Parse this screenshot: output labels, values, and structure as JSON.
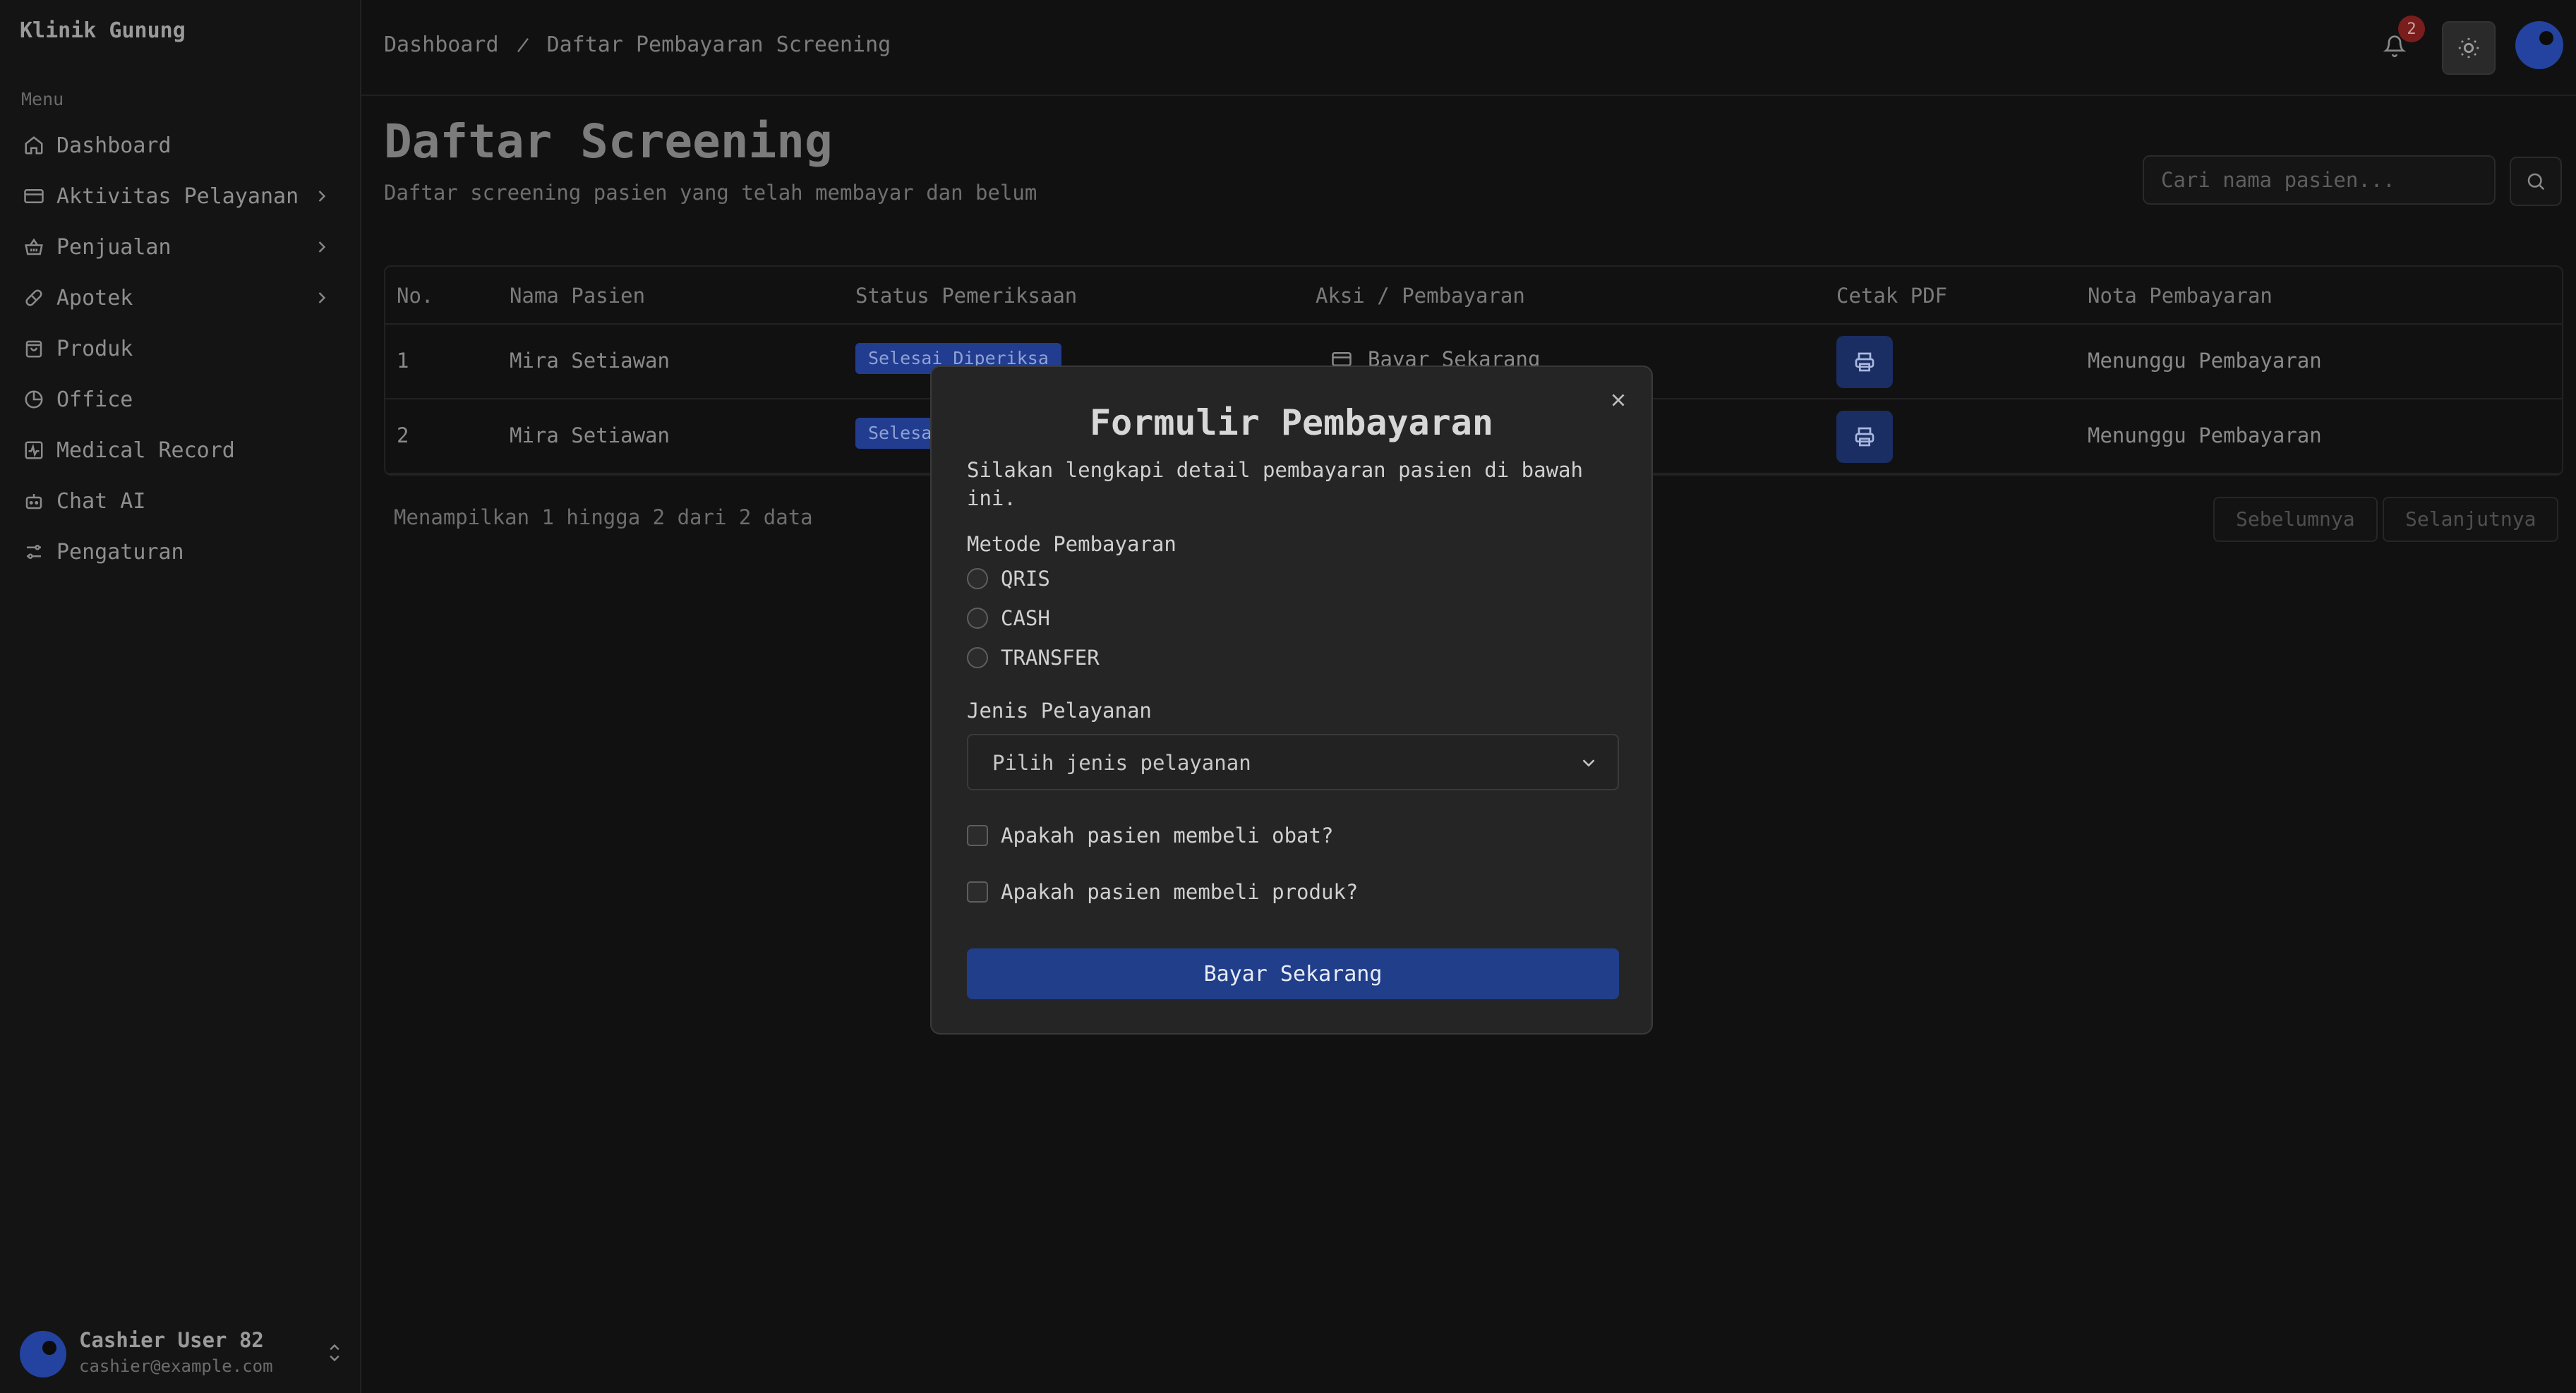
{
  "app": {
    "brand": "Klinik Gunung",
    "menu_label": "Menu"
  },
  "sidebar": {
    "items": [
      {
        "label": "Dashboard",
        "icon": "home-icon",
        "has_children": false
      },
      {
        "label": "Aktivitas Pelayanan",
        "icon": "card-icon",
        "has_children": true
      },
      {
        "label": "Penjualan",
        "icon": "basket-icon",
        "has_children": true
      },
      {
        "label": "Apotek",
        "icon": "pill-icon",
        "has_children": true
      },
      {
        "label": "Produk",
        "icon": "bag-icon",
        "has_children": false
      },
      {
        "label": "Office",
        "icon": "pie-chart-icon",
        "has_children": false
      },
      {
        "label": "Medical Record",
        "icon": "activity-icon",
        "has_children": false
      },
      {
        "label": "Chat AI",
        "icon": "bot-icon",
        "has_children": false
      },
      {
        "label": "Pengaturan",
        "icon": "sliders-icon",
        "has_children": false
      }
    ]
  },
  "user": {
    "name": "Cashier User 82",
    "email": "cashier@example.com"
  },
  "header": {
    "breadcrumb": [
      "Dashboard",
      "Daftar Pembayaran Screening"
    ],
    "notification_count": "2"
  },
  "page": {
    "title": "Daftar Screening",
    "subtitle": "Daftar screening pasien yang telah membayar dan belum",
    "search_placeholder": "Cari nama pasien..."
  },
  "table": {
    "headers": [
      "No.",
      "Nama Pasien",
      "Status Pemeriksaan",
      "Aksi / Pembayaran",
      "Cetak PDF",
      "Nota Pembayaran"
    ],
    "rows": [
      {
        "no": "1",
        "name": "Mira Setiawan",
        "status": "Selesai Diperiksa",
        "action": "Bayar Sekarang",
        "nota": "Menunggu Pembayaran"
      },
      {
        "no": "2",
        "name": "Mira Setiawan",
        "status": "Selesa",
        "action": "",
        "nota": "Menunggu Pembayaran"
      }
    ]
  },
  "pagination": {
    "info": "Menampilkan 1 hingga 2 dari 2 data",
    "prev": "Sebelumnya",
    "next": "Selanjutnya"
  },
  "modal": {
    "title": "Formulir Pembayaran",
    "description": "Silakan lengkapi detail pembayaran pasien di bawah ini.",
    "payment_method_label": "Metode Pembayaran",
    "payment_methods": [
      "QRIS",
      "CASH",
      "TRANSFER"
    ],
    "service_label": "Jenis Pelayanan",
    "service_placeholder": "Pilih jenis pelayanan",
    "check_medicine": "Apakah pasien membeli obat?",
    "check_product": "Apakah pasien membeli produk?",
    "submit": "Bayar Sekarang"
  }
}
